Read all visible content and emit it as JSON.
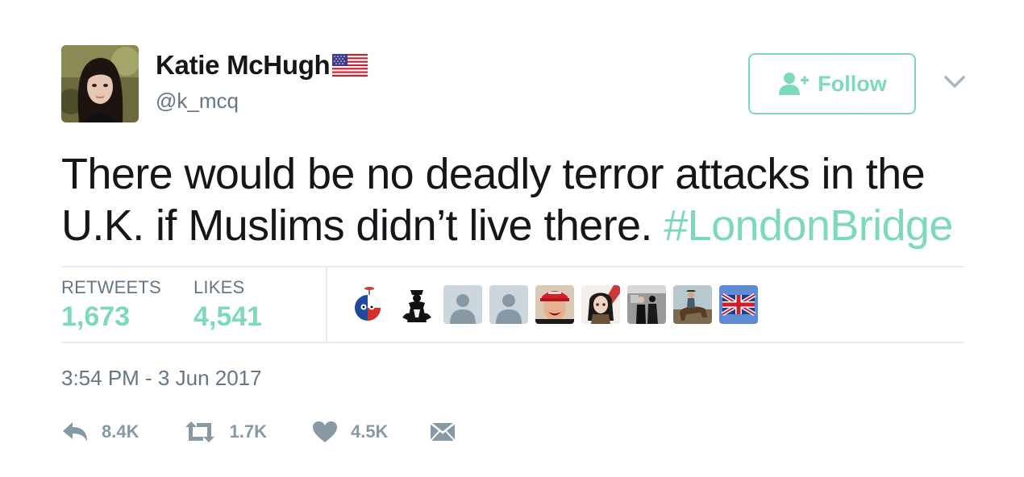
{
  "user": {
    "display_name": "Katie McHugh",
    "username": "@k_mcq",
    "flag_icon": "us-flag-icon"
  },
  "follow_button": {
    "label": "Follow",
    "icon": "add-user-icon"
  },
  "tweet": {
    "text": "There would be no deadly terror attacks in the U.K. if Muslims didn’t live there. ",
    "hashtag": "#LondonBridge"
  },
  "stats": {
    "retweets_label": "RETWEETS",
    "retweets_value": "1,673",
    "likes_label": "LIKES",
    "likes_value": "4,541"
  },
  "liker_avatars": [
    "countryball",
    "chess-queen",
    "default-user",
    "default-user",
    "red-cap",
    "anime",
    "couple",
    "horse-rider",
    "union-jack"
  ],
  "timestamp": "3:54 PM - 3 Jun 2017",
  "actions": {
    "reply_count": "8.4K",
    "retweet_count": "1.7K",
    "like_count": "4.5K"
  },
  "colors": {
    "accent": "#7ddab9",
    "text": "#14171a",
    "secondary": "#657786",
    "action_gray": "#8899a6",
    "divider": "#e6ecf0"
  }
}
